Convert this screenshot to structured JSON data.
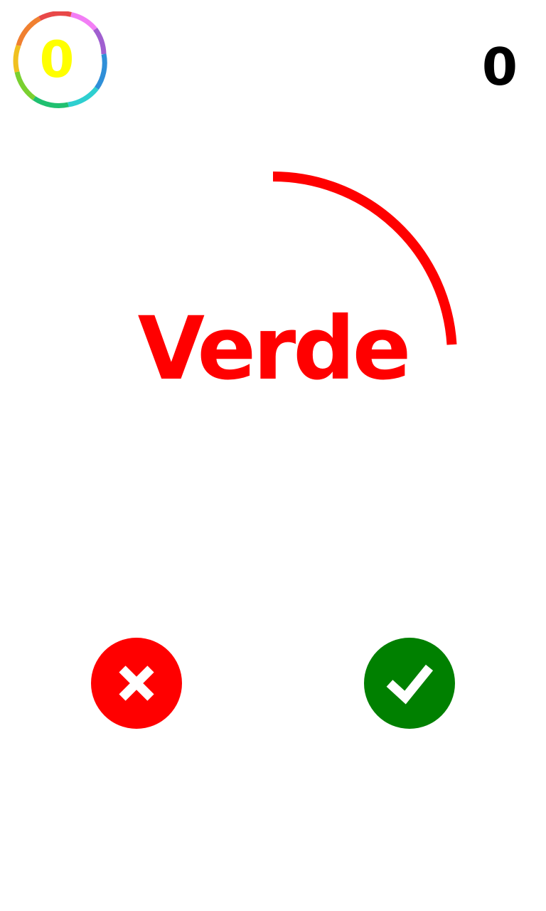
{
  "hud": {
    "level": "0",
    "score": "0"
  },
  "prompt": {
    "word": "Verde",
    "word_color": "#ff0000",
    "timer_color": "#ff0000",
    "timer_remaining_fraction": 0.24
  },
  "buttons": {
    "wrong": {
      "icon": "x-icon",
      "color": "#ff0000"
    },
    "right": {
      "icon": "check-icon",
      "color": "#008000"
    }
  },
  "colors": {
    "level_text": "#ffff00",
    "score_text": "#000000",
    "background": "#ffffff"
  }
}
